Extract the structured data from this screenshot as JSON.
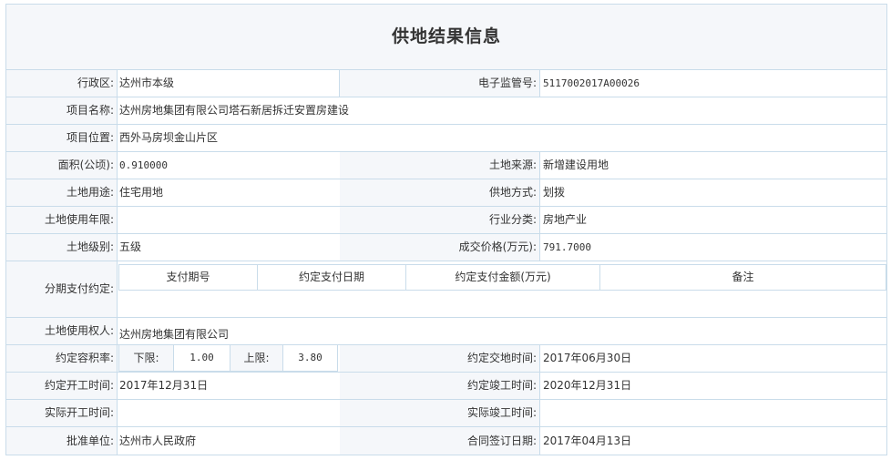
{
  "title": "供地结果信息",
  "fields": {
    "district": {
      "label": "行政区:",
      "value": "达州市本级"
    },
    "supervision_no": {
      "label": "电子监管号:",
      "value": "5117002017A00026"
    },
    "project_name": {
      "label": "项目名称:",
      "value": "达州房地集团有限公司塔石新居拆迁安置房建设"
    },
    "project_location": {
      "label": "项目位置:",
      "value": "西外马房坝金山片区"
    },
    "area": {
      "label": "面积(公顷):",
      "value": "0.910000"
    },
    "land_source": {
      "label": "土地来源:",
      "value": "新增建设用地"
    },
    "land_use": {
      "label": "土地用途:",
      "value": "住宅用地"
    },
    "supply_method": {
      "label": "供地方式:",
      "value": "划拨"
    },
    "use_term": {
      "label": "土地使用年限:",
      "value": ""
    },
    "industry": {
      "label": "行业分类:",
      "value": "房地产业"
    },
    "land_grade": {
      "label": "土地级别:",
      "value": "五级"
    },
    "price": {
      "label": "成交价格(万元):",
      "value": "791.7000"
    },
    "installments": {
      "label": "分期支付约定:",
      "headers": [
        "支付期号",
        "约定支付日期",
        "约定支付金额(万元)",
        "备注"
      ]
    },
    "land_user": {
      "label": "土地使用权人:",
      "value": "达州房地集团有限公司"
    },
    "plot_ratio": {
      "label": "约定容积率:",
      "lower_label": "下限:",
      "lower": "1.00",
      "upper_label": "上限:",
      "upper": "3.80"
    },
    "handover_date": {
      "label": "约定交地时间:",
      "value": "2017年06月30日"
    },
    "start_date": {
      "label": "约定开工时间:",
      "value": "2017年12月31日"
    },
    "completion_date": {
      "label": "约定竣工时间:",
      "value": "2020年12月31日"
    },
    "actual_start": {
      "label": "实际开工时间:",
      "value": ""
    },
    "actual_completion": {
      "label": "实际竣工时间:",
      "value": ""
    },
    "approval_unit": {
      "label": "批准单位:",
      "value": "达州市人民政府"
    },
    "contract_date": {
      "label": "合同签订日期:",
      "value": "2017年04月13日"
    }
  }
}
